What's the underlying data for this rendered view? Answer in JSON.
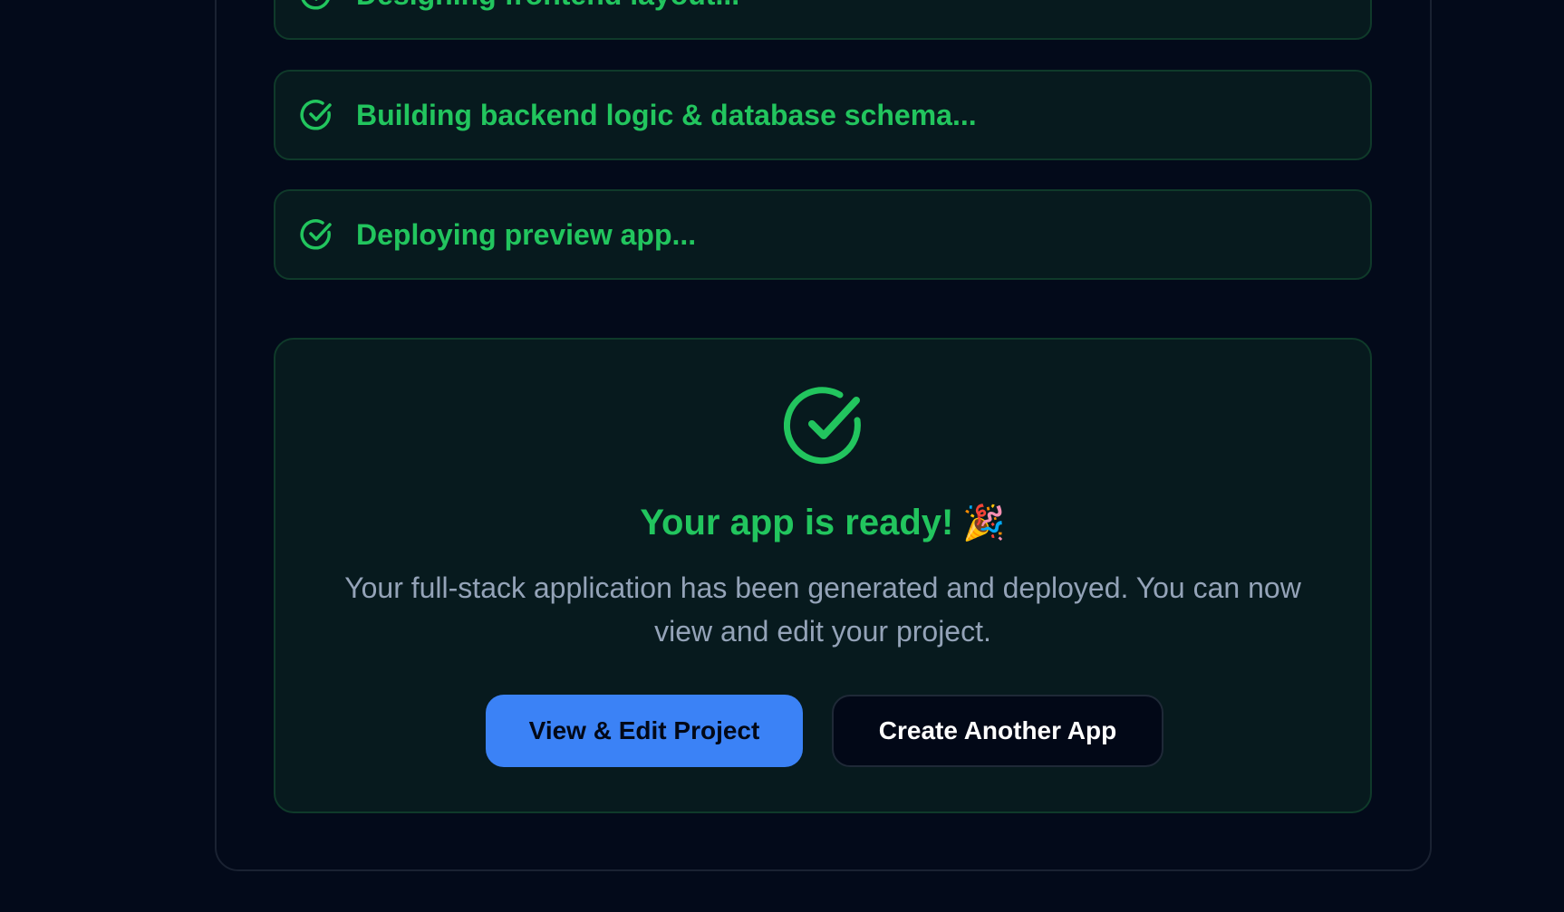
{
  "steps": [
    {
      "label": "Designing frontend layout...",
      "icon": "check-circle-icon",
      "status": "done"
    },
    {
      "label": "Building backend logic & database schema...",
      "icon": "check-circle-icon",
      "status": "done"
    },
    {
      "label": "Deploying preview app...",
      "icon": "check-circle-icon",
      "status": "done"
    }
  ],
  "success": {
    "icon": "check-circle-icon",
    "title": "Your app is ready!",
    "emoji": "🎉",
    "description": "Your full-stack application has been generated and deployed. You can now view and edit your project.",
    "primary_button": "View & Edit Project",
    "secondary_button": "Create Another App"
  },
  "colors": {
    "background": "#030a1a",
    "success_green": "#22c55e",
    "primary_blue": "#3b82f6",
    "muted_text": "#94a3b8"
  }
}
